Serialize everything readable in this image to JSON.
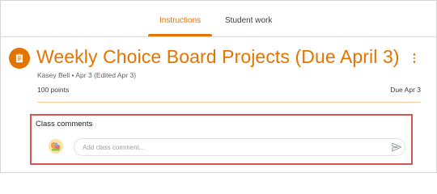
{
  "tabs": [
    {
      "label": "Instructions",
      "active": true
    },
    {
      "label": "Student work",
      "active": false
    }
  ],
  "assignment": {
    "icon": "assignment-icon",
    "title": "Weekly Choice Board Projects (Due April 3)",
    "meta": "Kasey Bell • Apr 3 (Edited Apr 3)",
    "points": "100 points",
    "due": "Due Apr 3"
  },
  "comments": {
    "label": "Class comments",
    "placeholder": "Add class comment...",
    "send_icon": "send-icon"
  },
  "colors": {
    "accent": "#e37400",
    "highlight_border": "#d9534f"
  }
}
